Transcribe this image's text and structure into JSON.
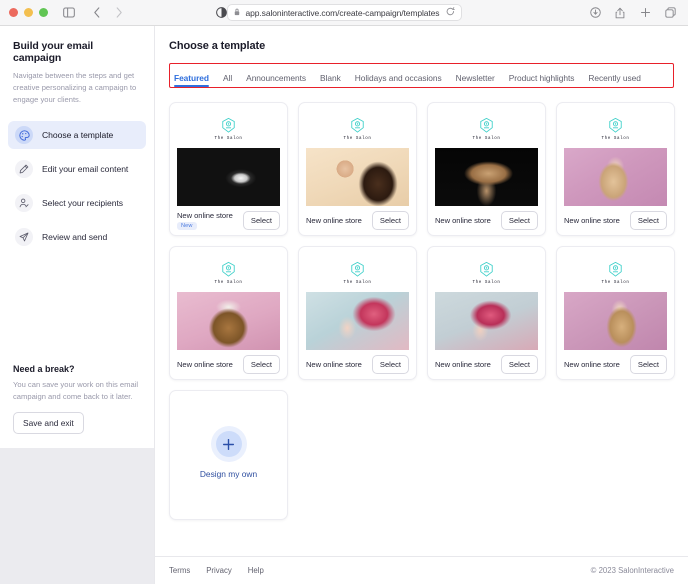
{
  "browser": {
    "url": "app.saloninteractive.com/create-campaign/templates",
    "lock_icon": "lock-icon",
    "reload_icon": "reload-icon",
    "reader_icon": "reader-view-icon",
    "sidebar_toggle_icon": "sidebar-toggle-icon",
    "back_icon": "back-arrow-icon",
    "forward_icon": "forward-arrow-icon",
    "right_icons": [
      "downloads-icon",
      "share-icon",
      "new-tab-icon",
      "tab-overview-icon"
    ]
  },
  "sidebar": {
    "title": "Build your email campaign",
    "subtitle": "Navigate between the steps and get creative personalizing a campaign to engage your clients.",
    "items": [
      {
        "label": "Choose a template",
        "icon": "palette-icon",
        "active": true
      },
      {
        "label": "Edit your email content",
        "icon": "pencil-icon",
        "active": false
      },
      {
        "label": "Select your recipients",
        "icon": "person-icon",
        "active": false
      },
      {
        "label": "Review and send",
        "icon": "paper-plane-icon",
        "active": false
      }
    ],
    "break_title": "Need a break?",
    "break_text": "You can save your work on this email campaign and come back to it later.",
    "save_label": "Save and exit"
  },
  "main": {
    "page_title": "Choose a template",
    "tabs": [
      {
        "label": "Featured",
        "active": true
      },
      {
        "label": "All",
        "active": false
      },
      {
        "label": "Announcements",
        "active": false
      },
      {
        "label": "Blank",
        "active": false
      },
      {
        "label": "Holidays and occasions",
        "active": false
      },
      {
        "label": "Newsletter",
        "active": false
      },
      {
        "label": "Product highlights",
        "active": false
      },
      {
        "label": "Recently used",
        "active": false
      }
    ],
    "template_brand": "The Salon",
    "select_label": "Select",
    "cards": [
      {
        "name": "New online store",
        "badge": "New",
        "photo": "ph1"
      },
      {
        "name": "New online store",
        "badge": "",
        "photo": "ph2"
      },
      {
        "name": "New online store",
        "badge": "",
        "photo": "ph3"
      },
      {
        "name": "New online store",
        "badge": "",
        "photo": "ph4"
      },
      {
        "name": "New online store",
        "badge": "",
        "photo": "ph5"
      },
      {
        "name": "New online store",
        "badge": "",
        "photo": "ph6"
      },
      {
        "name": "New online store",
        "badge": "",
        "photo": "ph7"
      },
      {
        "name": "New online store",
        "badge": "",
        "photo": "ph8"
      }
    ],
    "design_own_label": "Design my own",
    "design_own_icon": "plus-icon"
  },
  "footer": {
    "links": [
      "Terms",
      "Privacy",
      "Help"
    ],
    "copyright": "© 2023 SalonInteractive"
  },
  "colors": {
    "accent_blue": "#2f6fdd",
    "annotation_red": "#e8202a",
    "brand_teal": "#3fd0c9",
    "sidebar_active_bg": "#e8edfb"
  }
}
